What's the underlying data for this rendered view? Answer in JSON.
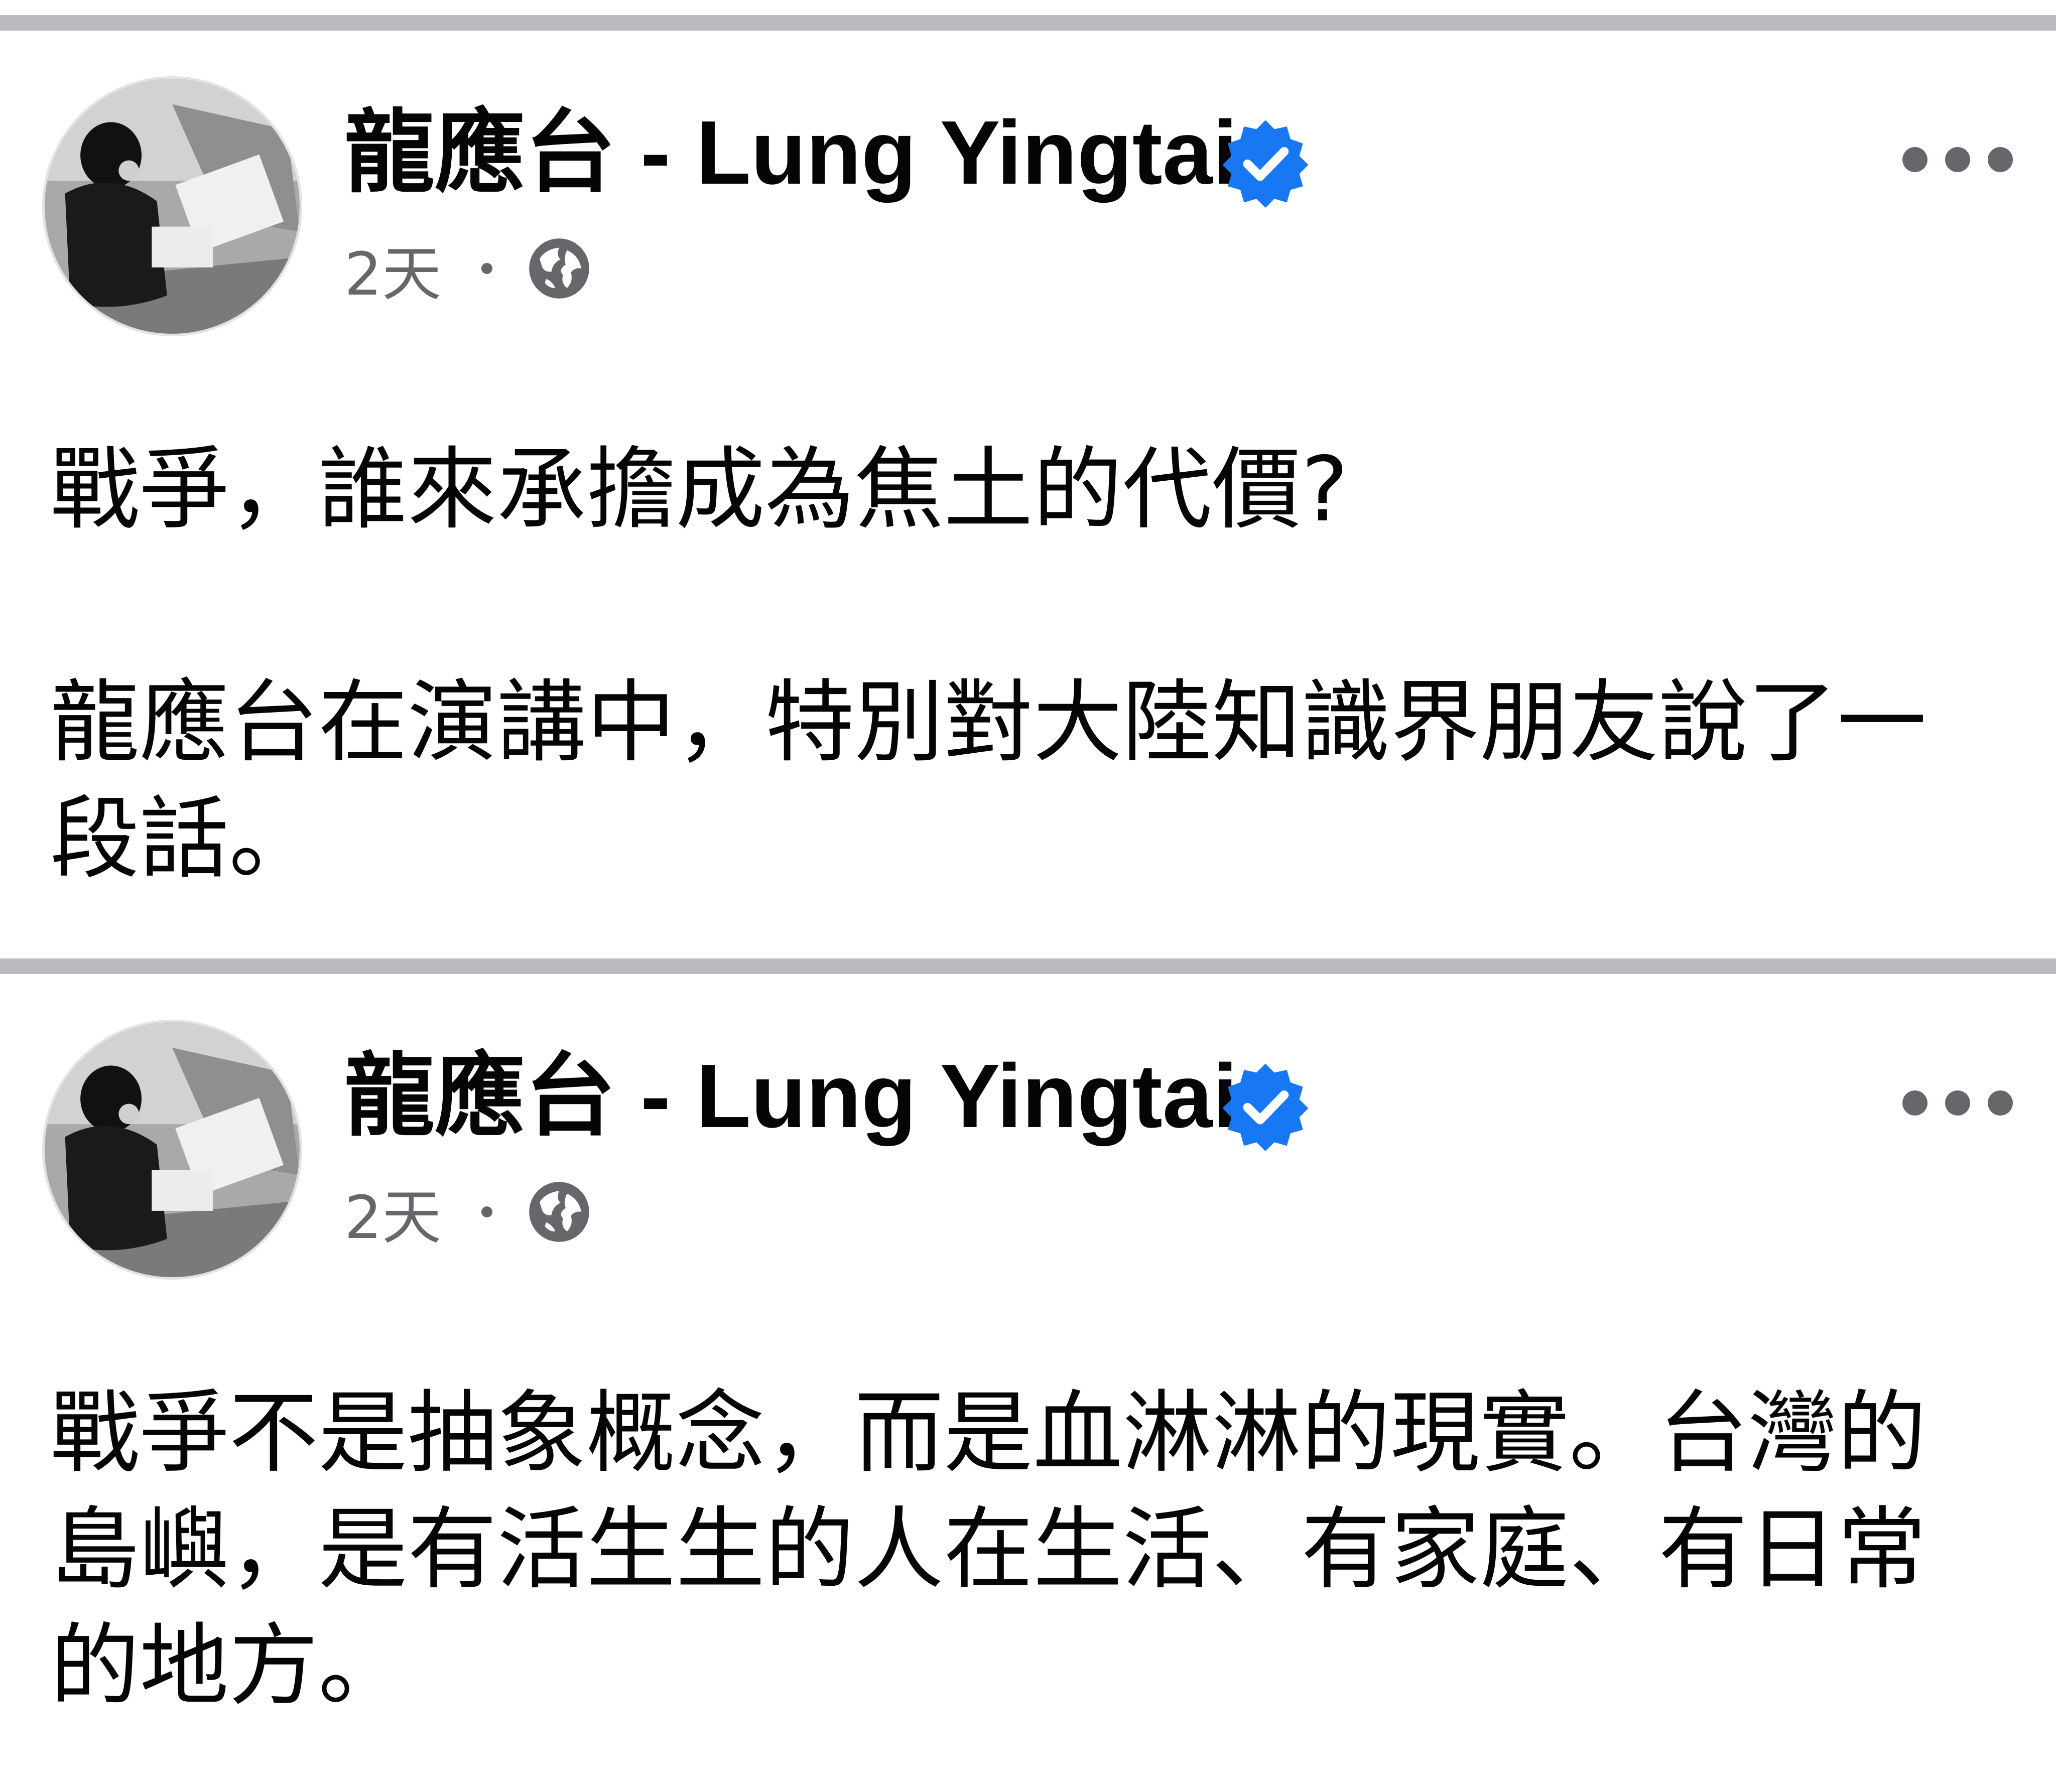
{
  "posts": [
    {
      "author": "龍應台 - Lung Yingtai",
      "timestamp": "2天",
      "verified": true,
      "privacy_icon": "globe-icon",
      "paragraphs": [
        "戰爭，誰來承擔成為焦土的代價?",
        "龍應台在演講中，特別對大陸知識界朋友說了一段話。"
      ]
    },
    {
      "author": "龍應台 - Lung Yingtai",
      "timestamp": "2天",
      "verified": true,
      "privacy_icon": "globe-icon",
      "paragraphs": [
        "戰爭不是抽象概念，而是血淋淋的現實。台灣的島嶼，是有活生生的人在生活、有家庭、有日常的地方。"
      ]
    }
  ],
  "colors": {
    "text_primary": "#050505",
    "text_secondary": "#65676b",
    "verified_badge": "#1877f2",
    "divider": "#b9bbc0"
  }
}
